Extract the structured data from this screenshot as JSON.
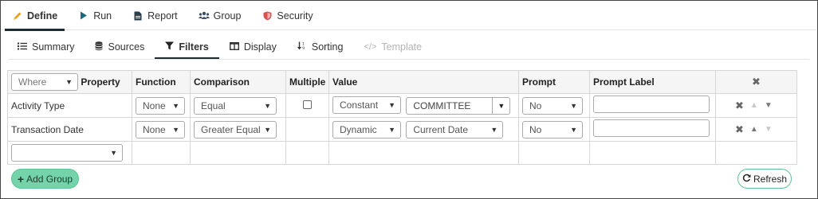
{
  "top_tabs": [
    {
      "label": "Define",
      "icon": "pencil-icon",
      "color": "#e8a21e"
    },
    {
      "label": "Run",
      "icon": "play-icon",
      "color": "#1b6d7a"
    },
    {
      "label": "Report",
      "icon": "file-icon",
      "color": "#2b3e4e"
    },
    {
      "label": "Group",
      "icon": "users-icon",
      "color": "#3a4f66"
    },
    {
      "label": "Security",
      "icon": "shield-icon",
      "color": "#d9534f"
    }
  ],
  "sub_tabs": [
    {
      "label": "Summary",
      "icon": "list-icon"
    },
    {
      "label": "Sources",
      "icon": "database-icon"
    },
    {
      "label": "Filters",
      "icon": "filter-icon"
    },
    {
      "label": "Display",
      "icon": "window-icon"
    },
    {
      "label": "Sorting",
      "icon": "sort-icon"
    },
    {
      "label": "Template",
      "icon": "code-icon"
    }
  ],
  "header": {
    "where_select": "Where",
    "property": "Property",
    "function": "Function",
    "comparison": "Comparison",
    "multiple": "Multiple",
    "value": "Value",
    "prompt": "Prompt",
    "prompt_label": "Prompt Label"
  },
  "rows": [
    {
      "property": "Activity Type",
      "function": "None",
      "comparison": "Equal",
      "value_type": "Constant",
      "value": "COMMITTEE",
      "prompt": "No",
      "prompt_label": ""
    },
    {
      "property": "Transaction Date",
      "function": "None",
      "comparison": "Greater Equal",
      "value_type": "Dynamic",
      "value": "Current Date",
      "prompt": "No",
      "prompt_label": ""
    }
  ],
  "buttons": {
    "add_group": "Add Group",
    "refresh": "Refresh"
  }
}
